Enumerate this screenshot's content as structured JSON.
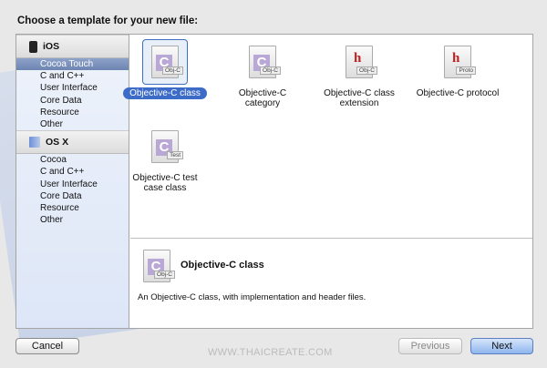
{
  "title": "Choose a template for your new file:",
  "sidebar": {
    "groups": [
      {
        "label": "iOS",
        "icon": "iphone-icon",
        "items": [
          "Cocoa Touch",
          "C and C++",
          "User Interface",
          "Core Data",
          "Resource",
          "Other"
        ]
      },
      {
        "label": "OS X",
        "icon": "finder-icon",
        "items": [
          "Cocoa",
          "C and C++",
          "User Interface",
          "Core Data",
          "Resource",
          "Other"
        ]
      }
    ],
    "selected": "Cocoa Touch"
  },
  "templates": [
    {
      "label": "Objective-C class",
      "glyph": "C",
      "tag": "Obj-C",
      "selected": true
    },
    {
      "label": "Objective-C category",
      "glyph": "C",
      "tag": "Obj-C"
    },
    {
      "label": "Objective-C class extension",
      "glyph": "h",
      "tag": "Obj-C"
    },
    {
      "label": "Objective-C protocol",
      "glyph": "h",
      "tag": "Proto"
    },
    {
      "label": "Objective-C test case class",
      "glyph": "C",
      "tag": "Test"
    }
  ],
  "detail": {
    "title": "Objective-C class",
    "glyph": "C",
    "tag": "Obj-C",
    "description": "An Objective-C class, with implementation and header files."
  },
  "buttons": {
    "cancel": "Cancel",
    "previous": "Previous",
    "next": "Next"
  },
  "watermark": "WWW.THAICREATE.COM"
}
